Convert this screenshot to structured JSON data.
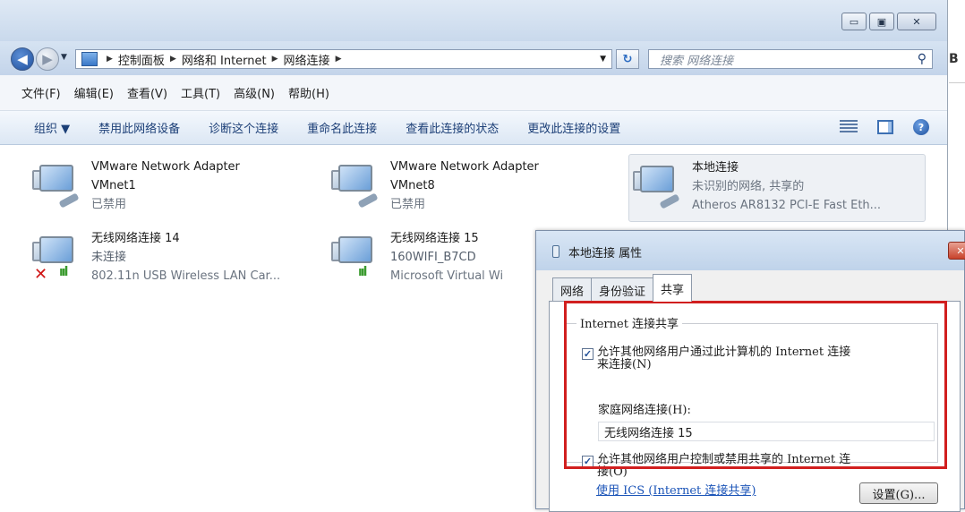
{
  "window": {
    "caption_buttons": [
      "▭",
      "▣",
      "✕"
    ]
  },
  "address": {
    "crumbs": [
      "控制面板",
      "网络和 Internet",
      "网络连接"
    ],
    "search_placeholder": "搜索 网络连接"
  },
  "menu": [
    "文件(F)",
    "编辑(E)",
    "查看(V)",
    "工具(T)",
    "高级(N)",
    "帮助(H)"
  ],
  "commands": [
    "组织 ▼",
    "禁用此网络设备",
    "诊断这个连接",
    "重命名此连接",
    "查看此连接的状态",
    "更改此连接的设置"
  ],
  "connections": [
    {
      "name": "VMware Network Adapter",
      "line2": "VMnet1",
      "line3": "已禁用",
      "icon": "wired-adapter-icon"
    },
    {
      "name": "VMware Network Adapter",
      "line2": "VMnet8",
      "line3": "已禁用",
      "icon": "wired-adapter-icon"
    },
    {
      "name": "本地连接",
      "line2": "未识别的网络, 共享的",
      "line3": "Atheros AR8132 PCI-E Fast Eth...",
      "icon": "wired-adapter-icon",
      "selected": true
    },
    {
      "name": "无线网络连接 14",
      "line2": "未连接",
      "line3": "802.11n USB Wireless LAN Car...",
      "icon": "wireless-disconnected-icon"
    },
    {
      "name": "无线网络连接 15",
      "line2": "160WIFI_B7CD",
      "line3": "Microsoft Virtual Wi",
      "icon": "wireless-adapter-icon"
    }
  ],
  "dialog": {
    "title": "本地连接 属性",
    "tabs": [
      "网络",
      "身份验证",
      "共享"
    ],
    "active_tab": "共享",
    "group_title": "Internet 连接共享",
    "allow_share_line1": "允许其他网络用户通过此计算机的 Internet 连接",
    "allow_share_line2": "来连接(N)",
    "allow_share_checked": true,
    "home_label": "家庭网络连接(H):",
    "home_value": "无线网络连接 15",
    "allow_control_line1": "允许其他网络用户控制或禁用共享的 Internet 连",
    "allow_control_line2": "接(O)",
    "allow_control_checked": true,
    "ics_link": "使用 ICS (Internet 连接共享)",
    "settings_button": "设置(G)..."
  },
  "edge_text": "B",
  "colors": {
    "highlight_box": "#d11f1f",
    "link": "#1c55b8",
    "command_text": "#1c3f77"
  }
}
